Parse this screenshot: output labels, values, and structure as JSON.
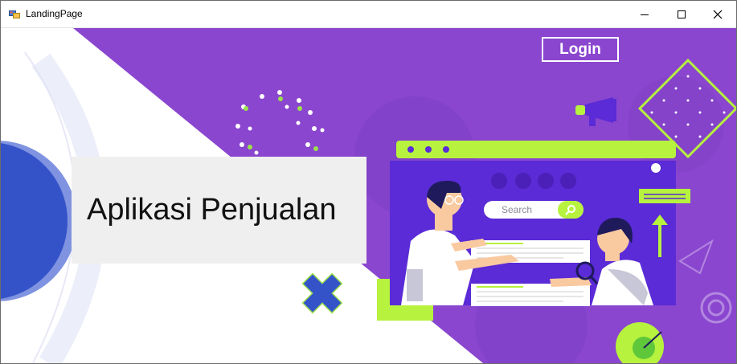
{
  "window": {
    "title": "LandingPage",
    "controls": [
      "minimize",
      "maximize",
      "close"
    ]
  },
  "hero": {
    "title": "Aplikasi Penjualan",
    "login_label": "Login",
    "search_placeholder": "Search"
  },
  "colors": {
    "purple": "#8a46cf",
    "purple_dark": "#5a2bd6",
    "lime": "#b6f23e",
    "blue": "#2f4ec8",
    "card_bg": "#efefef"
  }
}
